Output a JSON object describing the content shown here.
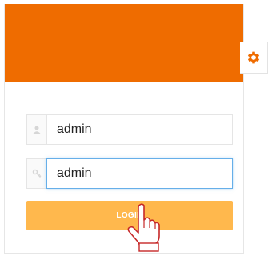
{
  "login_form": {
    "username_value": "admin",
    "password_value": "admin",
    "login_label": "LOGIN"
  },
  "icons": {
    "settings": "gear-icon",
    "username": "user-icon",
    "password": "key-icon",
    "cursor": "hand-pointer-icon"
  },
  "colors": {
    "header": "#ef6c00",
    "button": "#ffb84d",
    "focus_border": "#66afe9"
  }
}
